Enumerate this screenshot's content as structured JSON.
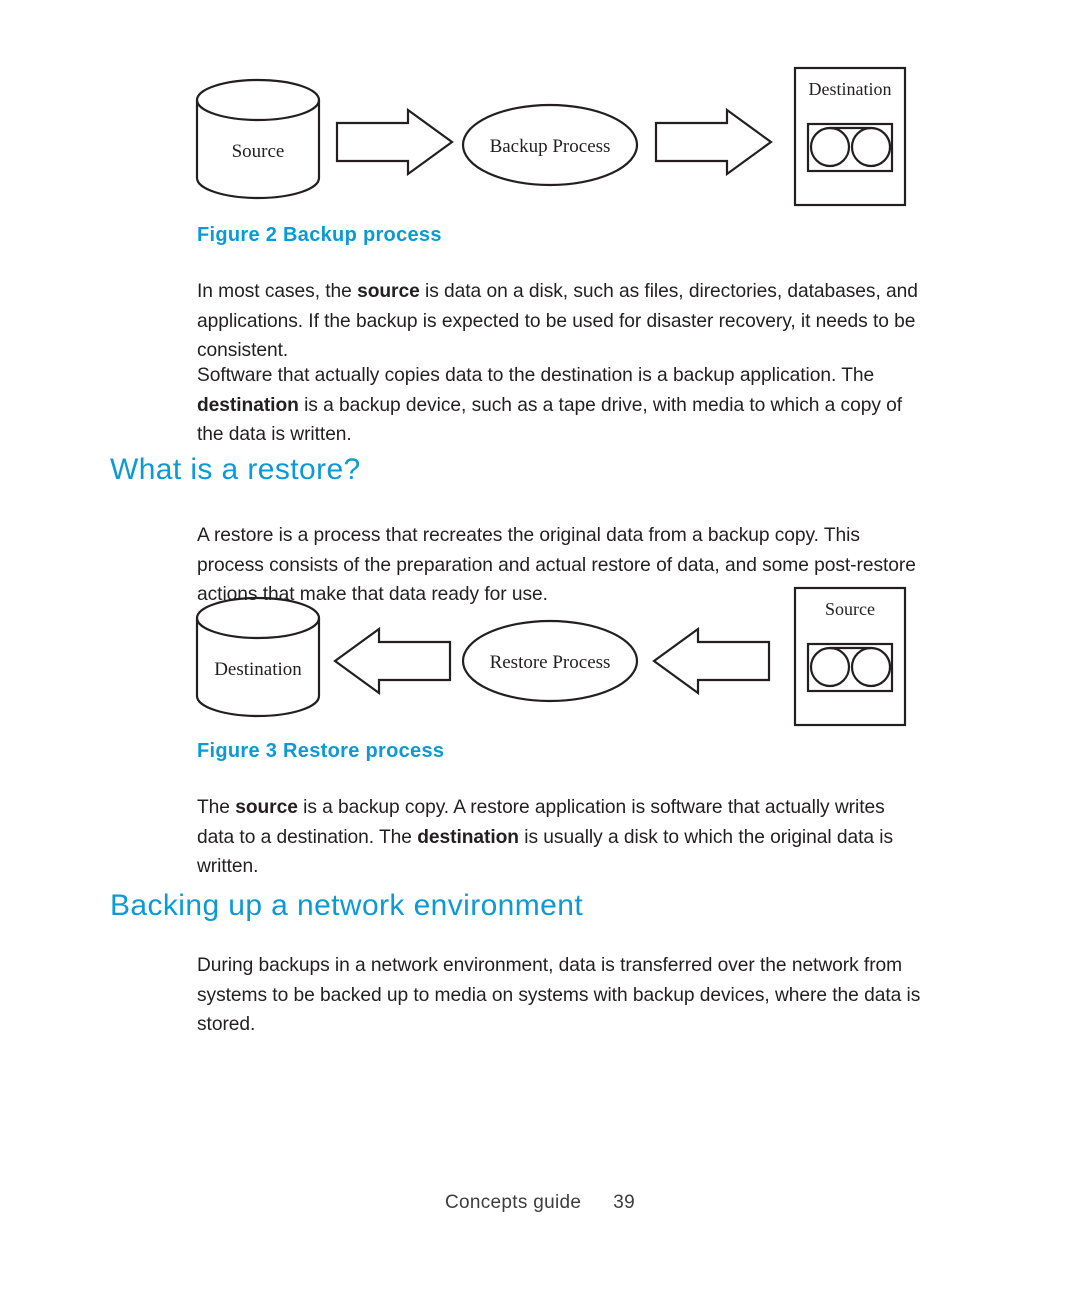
{
  "document": {
    "footer_text": "Concepts guide",
    "page_number": "39"
  },
  "theme": {
    "heading_blue": "#0b9ad6",
    "body_black": "#231f20",
    "page_background": "#ffffff"
  },
  "figure_backup": {
    "caption": "Figure 2 Backup process",
    "source_label": "Source",
    "process_label": "Backup Process",
    "destination_label": "Destination",
    "flow_direction": "left-to-right"
  },
  "figure_restore": {
    "caption": "Figure 3 Restore process",
    "destination_label": "Destination",
    "process_label": "Restore Process",
    "source_label": "Source",
    "flow_direction": "right-to-left"
  },
  "content": {
    "para_backup_1_a": "In most cases, the ",
    "para_backup_1_b": "source",
    "para_backup_1_c": " is data on a disk, such as files, directories, databases, and applications. If the backup is expected to be used for disaster recovery, it needs to be consistent.",
    "para_backup_2_a": "Software that actually copies data to the destination is a backup application. The ",
    "para_backup_2_b": "destination",
    "para_backup_2_c": " is a backup device, such as a tape drive, with media to which a copy of the data is written.",
    "heading_restore": "What is a restore?",
    "para_restore_intro": "A restore is a process that recreates the original data from a backup copy. This process consists of the preparation and actual restore of data, and some post-restore actions that make that data ready for use.",
    "para_restore_after_a": "The ",
    "para_restore_after_b": "source",
    "para_restore_after_c": " is a backup copy. A restore application is software that actually writes data to a destination. The ",
    "para_restore_after_d": "destination",
    "para_restore_after_e": " is usually a disk to which the original data is written.",
    "heading_network": "Backing up a network environment",
    "para_network": "During backups in a network environment, data is transferred over the network from systems to be backed up to media on systems with backup devices, where the data is stored."
  }
}
